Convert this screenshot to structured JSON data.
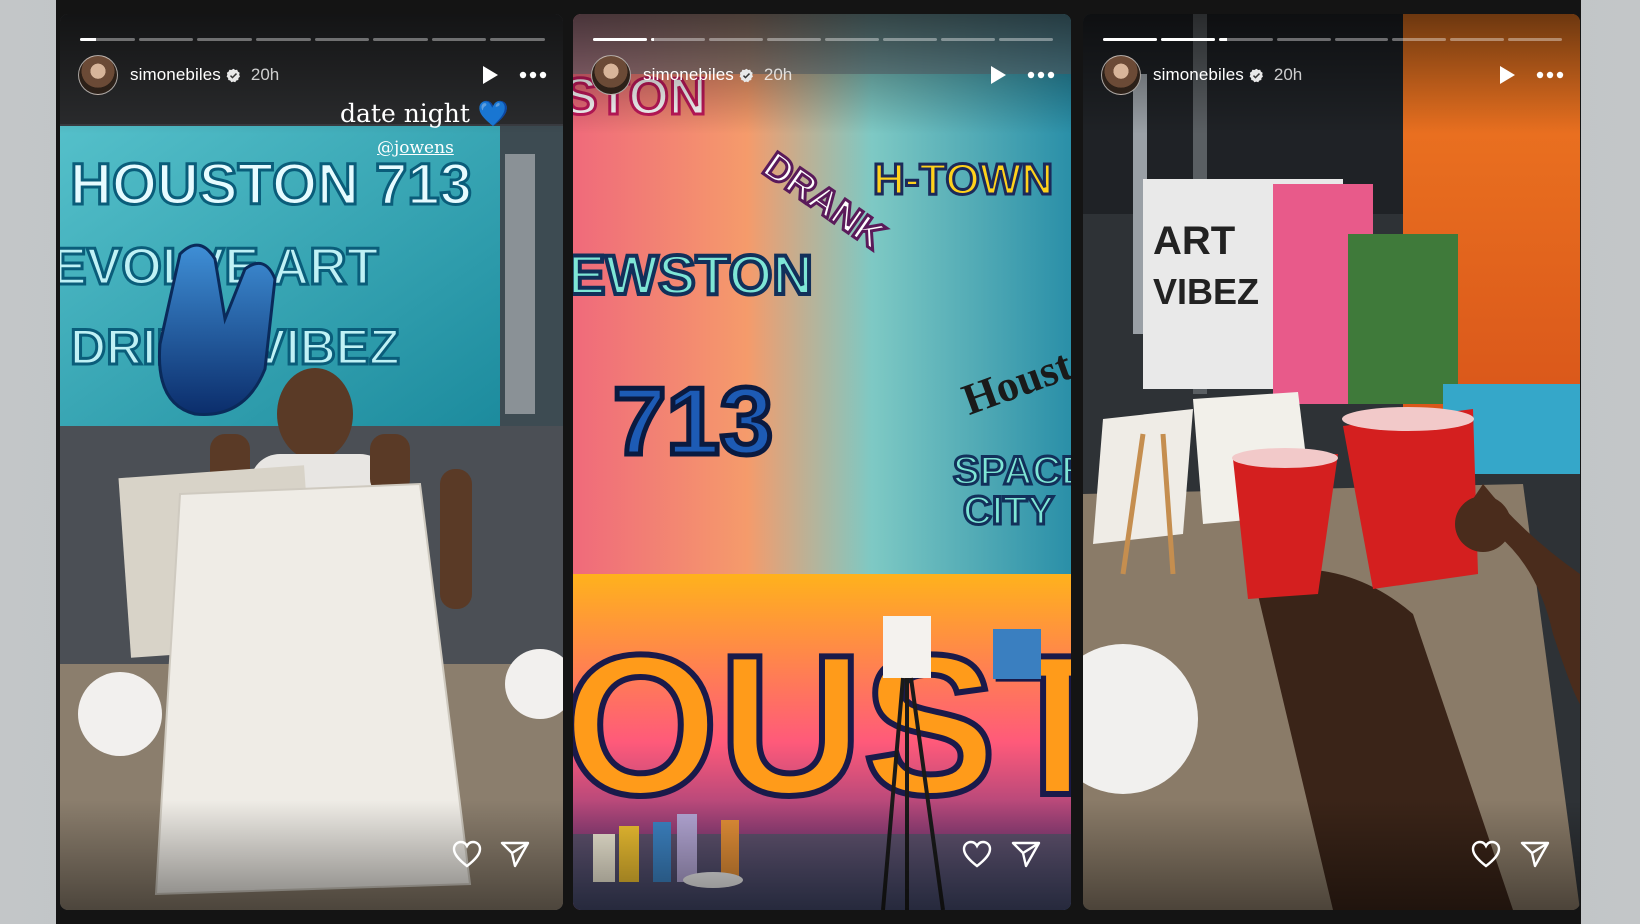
{
  "stories": [
    {
      "username": "simonebiles",
      "time": "20h",
      "progress": {
        "segments": 8,
        "active_index": 0,
        "active_fill_pct": 0.3
      },
      "caption": {
        "text": "date night",
        "emoji": "💙",
        "mention": "@jowens"
      }
    },
    {
      "username": "simonebiles",
      "time": "20h",
      "progress": {
        "segments": 8,
        "active_index": 1,
        "active_fill_pct": 0.05
      }
    },
    {
      "username": "simonebiles",
      "time": "20h",
      "progress": {
        "segments": 8,
        "active_index": 2,
        "active_fill_pct": 0.15
      }
    }
  ],
  "icons": [
    "play-icon",
    "more-icon",
    "heart-icon",
    "send-icon",
    "verified-badge-icon"
  ],
  "colors": {
    "overlay_text": "#ffffff",
    "cup_red": "#d41f1f",
    "graffiti_teal": "#1fa7b2"
  }
}
